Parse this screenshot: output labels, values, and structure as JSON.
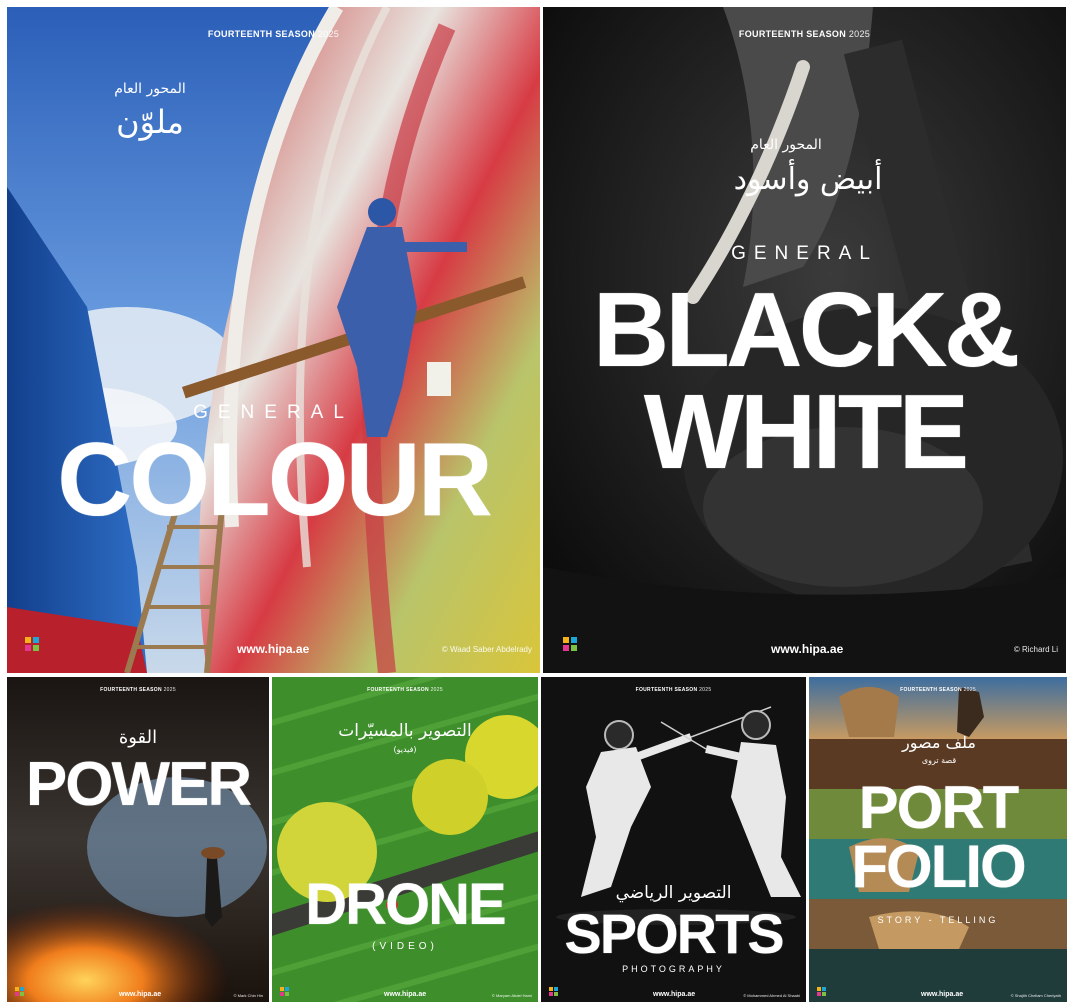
{
  "posters": {
    "colour": {
      "season": "FOURTEENTH SEASON",
      "year": "2025",
      "arabic_small": "المحور العام",
      "arabic_title": "ملوّن",
      "subtitle": "GENERAL",
      "title": "COLOUR",
      "website": "www.hipa.ae",
      "credit": "© Waad Saber Abdelrady"
    },
    "bw": {
      "season": "FOURTEENTH SEASON",
      "year": "2025",
      "arabic_small": "المحور العام",
      "arabic_title": "أبيض وأسود",
      "subtitle": "GENERAL",
      "title_line1": "BLACK&",
      "title_line2": "WHITE",
      "website": "www.hipa.ae",
      "credit": "© Richard Li"
    },
    "power": {
      "season": "FOURTEENTH SEASON",
      "year": "2025",
      "arabic_title": "القوة",
      "title": "POWER",
      "website": "www.hipa.ae",
      "credit": "© Mark Chin Hin"
    },
    "drone": {
      "season": "FOURTEENTH SEASON",
      "year": "2025",
      "arabic_title": "التصوير بالمسيّرات",
      "arabic_sub": "(فيديو)",
      "title": "DRONE",
      "subtitle": "(VIDEO)",
      "website": "www.hipa.ae",
      "credit": "© Maryam Abdel Hami"
    },
    "sports": {
      "season": "FOURTEENTH SEASON",
      "year": "2025",
      "arabic_title": "التصوير الرياضي",
      "title": "SPORTS",
      "subtitle": "PHOTOGRAPHY",
      "website": "www.hipa.ae",
      "credit": "© Mohammed Ahmed Al Shaabi"
    },
    "portfolio": {
      "season": "FOURTEENTH SEASON",
      "year": "2025",
      "arabic_title": "ملف مصور",
      "arabic_sub": "قصة تروى",
      "title_line1": "PORT",
      "title_line2": "FOLIO",
      "subtitle": "STORY - TELLING",
      "website": "www.hipa.ae",
      "credit": "© Shajith Chellam Cheriyath"
    }
  },
  "logo_colors": [
    "#f5b21b",
    "#1fa6d8",
    "#e3388f",
    "#7cc242"
  ]
}
